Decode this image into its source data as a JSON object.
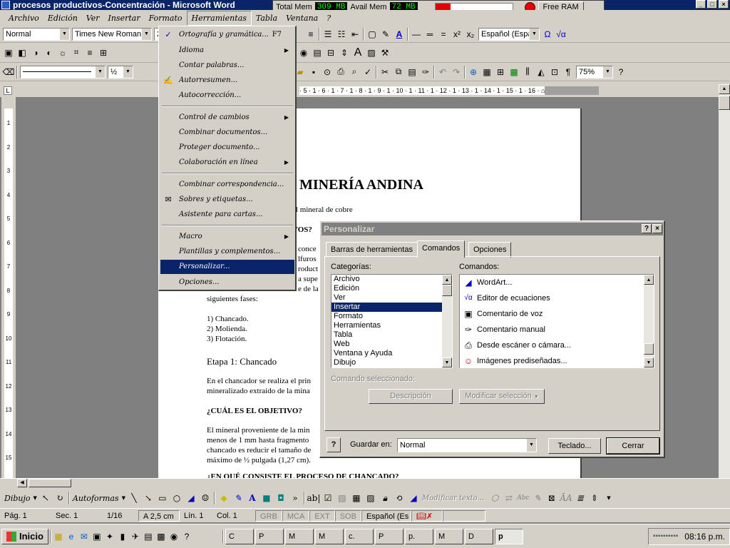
{
  "window": {
    "title": "procesos productivos-Concentración - Microsoft Word"
  },
  "memory_monitor": {
    "total_label": "Total Mem",
    "total_value": "309 MB",
    "avail_label": "Avail Mem",
    "avail_value": "72 MB",
    "usage_fraction": 0.2,
    "free_button": "Free RAM"
  },
  "menubar": {
    "items": [
      "Archivo",
      "Edición",
      "Ver",
      "Insertar",
      "Formato",
      "Herramientas",
      "Tabla",
      "Ventana",
      "?"
    ]
  },
  "format_toolbar": {
    "style": "Normal",
    "font": "Times New Roman",
    "size": "2",
    "language": "Español (Españ"
  },
  "standard_toolbar": {
    "zoom": "75%"
  },
  "line_toolbar": {
    "weight": "½"
  },
  "ruler_text": "· 5 · 1 · 6 · 1 · 7 · 1 · 8 · 1 · 9 · 1 · 10 · 1 · 11 · 1 · 12 · 1 · 13 · 1 · 14 · 1 · 15 · 1 · 16 · ⌂ · 17 · 1 · 18 ·",
  "vruler_ticks": [
    "1",
    "2",
    "3",
    "4",
    "5",
    "6",
    "7",
    "8",
    "9",
    "10",
    "11",
    "12",
    "13",
    "14",
    "15"
  ],
  "tools_menu": {
    "items": [
      {
        "label": "Ortografía y gramática...",
        "shortcut": "F7"
      },
      {
        "label": "Idioma"
      },
      {
        "label": "Contar palabras..."
      },
      {
        "label": "Autorresumen..."
      },
      {
        "label": "Autocorrección..."
      },
      {
        "label": "Control de cambios"
      },
      {
        "label": "Combinar documentos..."
      },
      {
        "label": "Proteger documento..."
      },
      {
        "label": "Colaboración en línea"
      },
      {
        "label": "Combinar correspondencia..."
      },
      {
        "label": "Sobres y etiquetas..."
      },
      {
        "label": "Asistente para cartas..."
      },
      {
        "label": "Macro"
      },
      {
        "label": "Plantillas y complementos..."
      },
      {
        "label": "Personalizar..."
      },
      {
        "label": "Opciones..."
      }
    ]
  },
  "document": {
    "heading": "MINERÍA ANDINA",
    "lines": [
      "al mineral de cobre",
      "VOS?",
      "conce",
      "lfuros",
      "roduct",
      "a supe",
      "e de la",
      "siguientes fases:",
      "1) Chancado.",
      "2) Molienda.",
      "3) Flotación.",
      "Etapa 1: Chancado",
      "En el chancador se realiza el prin",
      "mineralizado extraído de la mina",
      "¿CUÁL ES EL OBJETIVO?",
      "El mineral proveniente de la min",
      "menos de 1 mm hasta fragmento",
      "chancado es reducir el tamaño de",
      "máximo de ½ pulgada (1,27 cm).",
      "¿EN QUÉ CONSISTE EL PROCESO DE CHANCADO?"
    ]
  },
  "dialog": {
    "title": "Personalizar",
    "help_btn": "?",
    "close_btn": "×",
    "tabs": [
      "Barras de herramientas",
      "Comandos",
      "Opciones"
    ],
    "categories_label": "Categorías:",
    "categories": [
      "Archivo",
      "Edición",
      "Ver",
      "Insertar",
      "Formato",
      "Herramientas",
      "Tabla",
      "Web",
      "Ventana y Ayuda",
      "Dibujo"
    ],
    "commands_label": "Comandos:",
    "commands": [
      "WordArt...",
      "Editor de ecuaciones",
      "Comentario de voz",
      "Comentario manual",
      "Desde escáner o cámara...",
      "Imágenes prediseñadas..."
    ],
    "selected_label": "Comando seleccionado:",
    "desc_btn": "Descripción",
    "modify_btn": "Modificar selección",
    "save_label": "Guardar en:",
    "save_value": "Normal",
    "keyboard_btn": "Teclado...",
    "close_button": "Cerrar"
  },
  "drawing_toolbar": {
    "draw": "Dibujo",
    "autoshapes": "Autoformas",
    "modify_text": "Modificar texto..."
  },
  "statusbar": {
    "page": "Pág. 1",
    "section": "Sec. 1",
    "pages": "1/16",
    "at": "A 2,5 cm",
    "line": "Lín. 1",
    "col": "Col. 1",
    "rec": "GRB",
    "trk": "MCA",
    "ext": "EXT",
    "ovr": "SOB",
    "lang": "Español (Es"
  },
  "taskbar": {
    "start": "Inicio",
    "tasks": [
      "C",
      "P",
      "M",
      "M",
      "c.",
      "P",
      "p.",
      "M",
      "D",
      "p"
    ],
    "clock": "08:16 p.m."
  }
}
